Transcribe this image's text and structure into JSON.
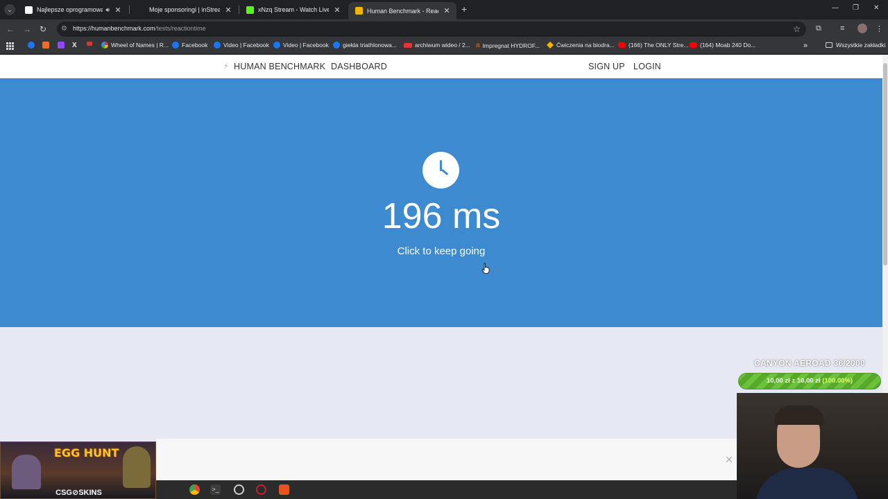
{
  "browser": {
    "tabs": [
      {
        "title": "Najlepsze oprogramowanie",
        "active": false,
        "favicon_color": "#ffffff",
        "muted_icon": true
      },
      {
        "title": "Moje sponsoringi | inStreamly",
        "active": false,
        "favicon_color": "#202124"
      },
      {
        "title": "xNzq Stream - Watch Live on K",
        "active": false,
        "favicon_color": "#53fc18"
      },
      {
        "title": "Human Benchmark - Reaction T",
        "active": true,
        "favicon_color": "#f4b400"
      }
    ],
    "new_tab_label": "+",
    "url_host": "https://humanbenchmark.com",
    "url_path": "/tests/reactiontime",
    "bookmarks": [
      {
        "label": "",
        "icon_color": "#1877f2"
      },
      {
        "label": "",
        "icon_color": "#f36c21"
      },
      {
        "label": "",
        "icon_color": "#9146ff"
      },
      {
        "label": "",
        "icon_color": "#000000"
      },
      {
        "label": "",
        "icon_color": "#e0362f"
      },
      {
        "label": "Wheel of Names | R...",
        "icon_color": "#e0362f"
      },
      {
        "label": "Facebook",
        "icon_color": "#1877f2"
      },
      {
        "label": "Video | Facebook",
        "icon_color": "#1877f2"
      },
      {
        "label": "Video | Facebook",
        "icon_color": "#1877f2"
      },
      {
        "label": "giełda triathlonowa...",
        "icon_color": "#1877f2"
      },
      {
        "label": "archiwum wideo / 2...",
        "icon_color": "#e0362f"
      },
      {
        "label": "Impregnat HYDROF...",
        "icon_color": "#e8710a"
      },
      {
        "label": "Ćwiczenia na biodra...",
        "icon_color": "#f4b400"
      },
      {
        "label": "(166) The ONLY Stre...",
        "icon_color": "#ff0000"
      },
      {
        "label": "(164) Moab 240 Do...",
        "icon_color": "#ff0000"
      }
    ],
    "all_bookmarks_label": "Wszystkie zakładki"
  },
  "site": {
    "nav": {
      "brand": "HUMAN BENCHMARK",
      "dashboard": "DASHBOARD",
      "signup": "SIGN UP",
      "login": "LOGIN"
    },
    "result": "196 ms",
    "subtitle": "Click to keep going"
  },
  "overlays": {
    "egg_hunt_title": "EGG HUNT",
    "egg_hunt_brand": "CSG⊘SKINS",
    "goal_title": "CANYON AEROAD 36/2000",
    "goal_current": "10,00 zł",
    "goal_sep": "z",
    "goal_target": "10,00 zł",
    "goal_percent": "(100.00%)"
  },
  "colors": {
    "hero_blue": "#3d8ad0",
    "page_bg": "#e6e8f4",
    "goal_green": "#6cc23a"
  }
}
